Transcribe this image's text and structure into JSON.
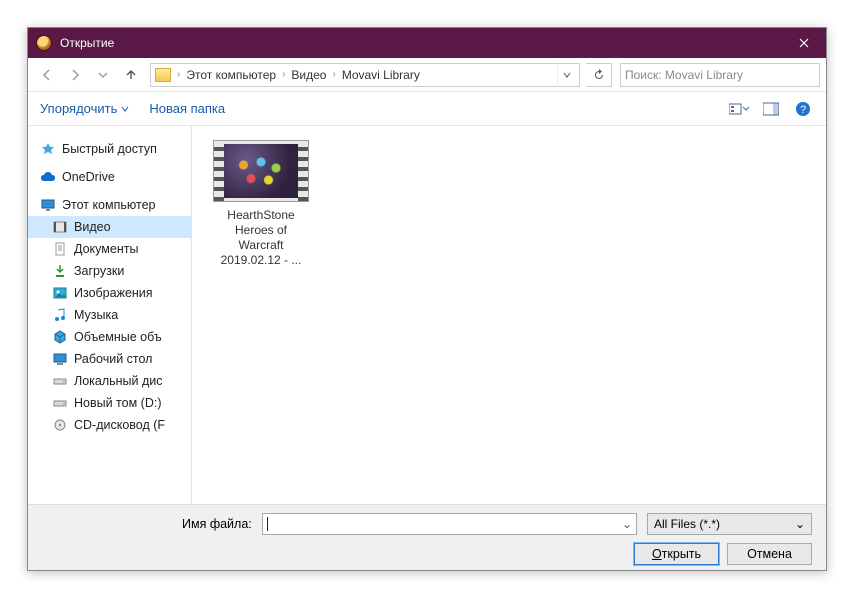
{
  "window": {
    "title": "Открытие"
  },
  "nav": {
    "path": [
      "Этот компьютер",
      "Видео",
      "Movavi Library"
    ],
    "search_placeholder": "Поиск: Movavi Library"
  },
  "toolbar": {
    "organize": "Упорядочить",
    "new_folder": "Новая папка"
  },
  "sidebar": {
    "quick_access": "Быстрый доступ",
    "onedrive": "OneDrive",
    "this_pc": "Этот компьютер",
    "items": [
      "Видео",
      "Документы",
      "Загрузки",
      "Изображения",
      "Музыка",
      "Объемные объ",
      "Рабочий стол",
      "Локальный дис",
      "Новый том (D:)",
      "CD-дисковод (F"
    ]
  },
  "files": [
    {
      "line1": "HearthStone",
      "line2": "Heroes of",
      "line3": "Warcraft",
      "line4": "2019.02.12 - ..."
    }
  ],
  "footer": {
    "filename_label": "Имя файла:",
    "filename_value": "",
    "filter": "All Files (*.*)",
    "open": "Открыть",
    "cancel": "Отмена"
  }
}
